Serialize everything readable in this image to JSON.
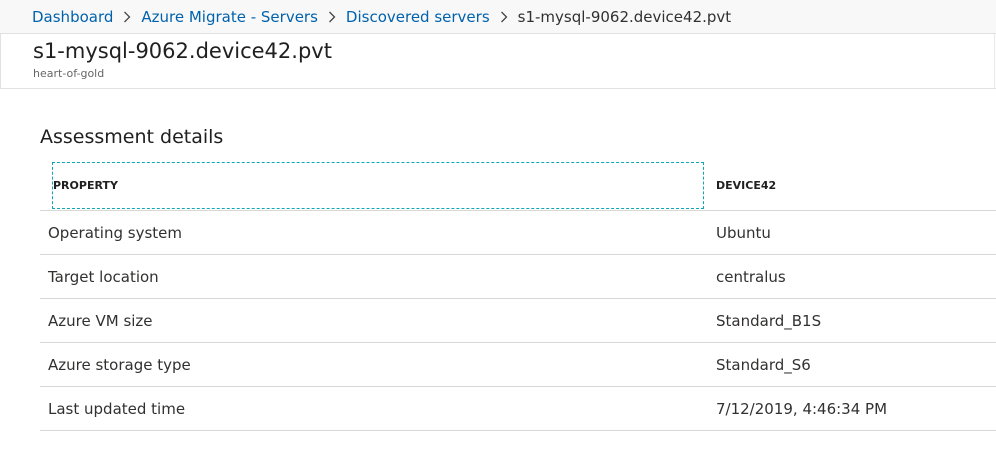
{
  "breadcrumb": {
    "items": [
      {
        "label": "Dashboard"
      },
      {
        "label": "Azure Migrate - Servers"
      },
      {
        "label": "Discovered servers"
      }
    ],
    "current": "s1-mysql-9062.device42.pvt"
  },
  "header": {
    "title": "s1-mysql-9062.device42.pvt",
    "subtitle": "heart-of-gold"
  },
  "section": {
    "title": "Assessment details"
  },
  "table": {
    "columns": [
      "PROPERTY",
      "DEVICE42"
    ],
    "rows": [
      {
        "property": "Operating system",
        "value": "Ubuntu"
      },
      {
        "property": "Target location",
        "value": "centralus"
      },
      {
        "property": "Azure VM size",
        "value": "Standard_B1S"
      },
      {
        "property": "Azure storage type",
        "value": "Standard_S6"
      },
      {
        "property": "Last updated time",
        "value": "7/12/2019, 4:46:34 PM"
      }
    ]
  },
  "colors": {
    "link": "#0062ad",
    "focus_outline": "#0fa6b6",
    "divider": "#d8d8d8"
  }
}
